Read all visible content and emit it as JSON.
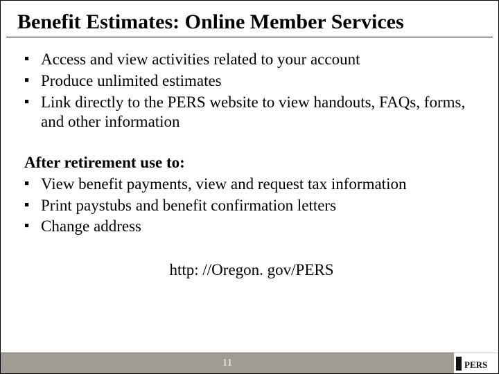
{
  "title": "Benefit Estimates:  Online Member Services",
  "bullets_top": [
    "Access and view activities related to your account",
    "Produce unlimited estimates",
    "Link directly to the PERS website to view handouts, FAQs, forms, and other information"
  ],
  "subhead": "After retirement use to:",
  "bullets_bottom": [
    "View benefit payments, view and request tax information",
    "Print paystubs and benefit confirmation letters",
    "Change address"
  ],
  "url": "http: //Oregon. gov/PERS",
  "page_number": "11",
  "logo_text": "PERS"
}
